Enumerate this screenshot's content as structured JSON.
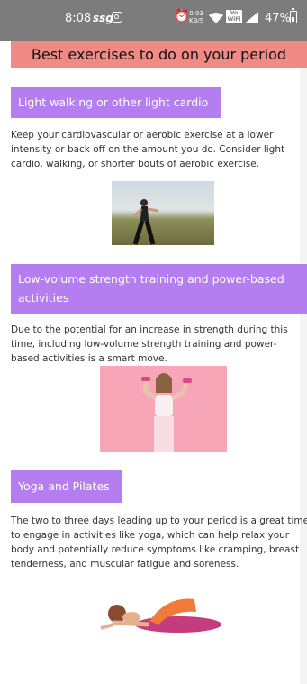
{
  "status_bar": {
    "time": "8:08",
    "app_badge": "ssg",
    "network_speed_top": "0.03",
    "network_speed_bottom": "KB/S",
    "volte_top": "Vo",
    "volte_bottom": "WiFi",
    "battery_percent": "47%",
    "icons": [
      "instagram-icon",
      "alarm-icon",
      "wifi-icon",
      "signal-icon",
      "battery-icon"
    ]
  },
  "page": {
    "title": "Best exercises to do on your period"
  },
  "sections": [
    {
      "heading": "Light walking or other light cardio",
      "body": "Keep your cardiovascular or aerobic exercise at a lower intensity or back off on the amount you do. Consider light cardio, walking, or shorter bouts of aerobic exercise."
    },
    {
      "heading": "Low-volume strength training and power-based activities",
      "body": "Due to the potential for an increase in strength during this time, including low-volume strength training and power-based activities is a smart move."
    },
    {
      "heading": "Yoga and Pilates",
      "body": "The two to three days leading up to your period is a great time to engage in activities like yoga, which can help relax your body and potentially reduce symptoms like cramping, breast tenderness, and muscular fatigue and soreness."
    }
  ],
  "colors": {
    "status_bar": "#7c7c7c",
    "header_bg": "#f08a84",
    "section_label_bg": "#b57ef0",
    "body_text": "#333333"
  }
}
